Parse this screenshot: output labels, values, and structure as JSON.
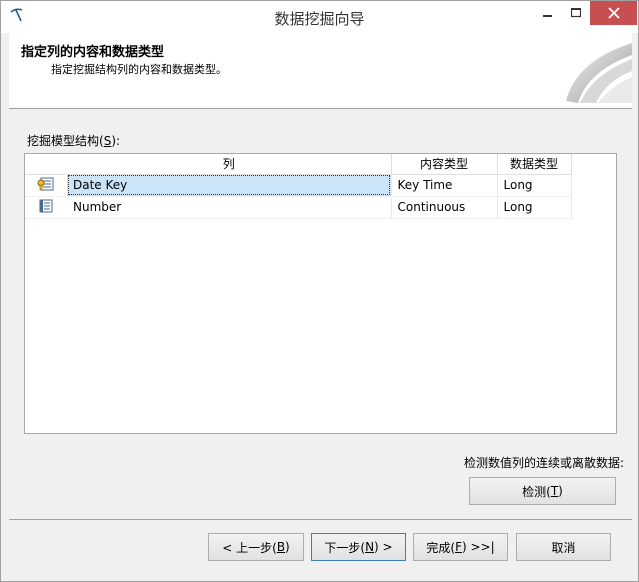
{
  "window": {
    "title": "数据挖掘向导"
  },
  "header": {
    "title": "指定列的内容和数据类型",
    "subtitle": "指定挖掘结构列的内容和数据类型。"
  },
  "structure": {
    "label_prefix": "挖掘模型结构(",
    "label_mnemonic": "S",
    "label_suffix": "):",
    "columns": [
      "列",
      "内容类型",
      "数据类型"
    ],
    "rows": [
      {
        "icon": "key-column-icon",
        "name": "Date Key",
        "content_type": "Key Time",
        "data_type": "Long",
        "selected": true
      },
      {
        "icon": "column-icon",
        "name": "Number",
        "content_type": "Continuous",
        "data_type": "Long",
        "selected": false
      }
    ]
  },
  "detect": {
    "label": "检测数值列的连续或离散数据:",
    "button_prefix": "检测(",
    "button_mnemonic": "T",
    "button_suffix": ")"
  },
  "footer": {
    "back_prefix": "< 上一步(",
    "back_mnemonic": "B",
    "back_suffix": ")",
    "next_prefix": "下一步(",
    "next_mnemonic": "N",
    "next_suffix": ") >",
    "finish_prefix": "完成(",
    "finish_mnemonic": "F",
    "finish_suffix": ") >>|",
    "cancel": "取消"
  },
  "colors": {
    "selection": "#cce4f7",
    "close_button": "#c74f50"
  }
}
